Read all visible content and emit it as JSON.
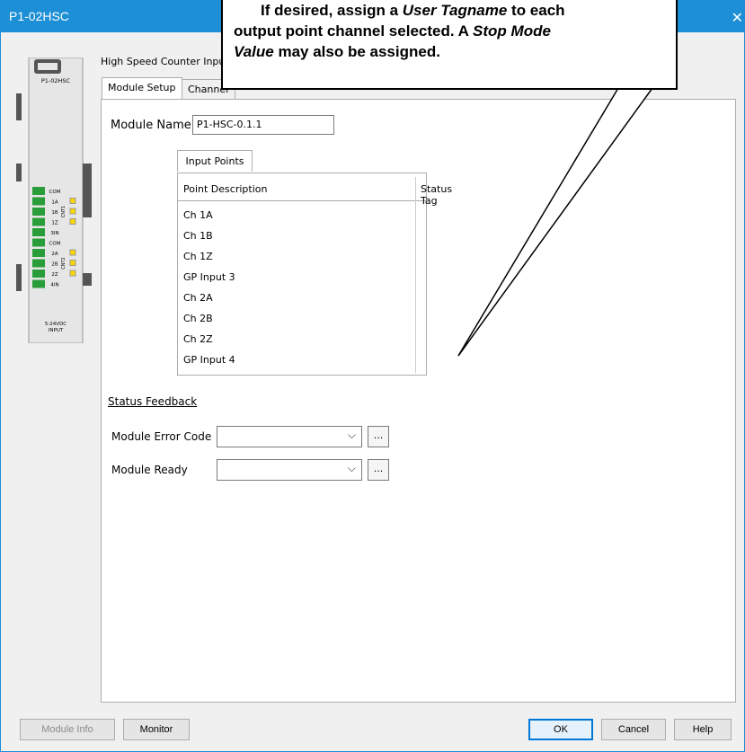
{
  "window": {
    "title": "P1-02HSC"
  },
  "module_image": {
    "part_number": "P1-02HSC",
    "terminals": [
      "COM",
      "1A",
      "1B",
      "1Z",
      "3IN",
      "COM",
      "2A",
      "2B",
      "2Z",
      "4IN"
    ],
    "channel_labels": [
      "CNT1",
      "CNT2"
    ],
    "footer": [
      "5-24VDC",
      "INPUT"
    ],
    "colors": {
      "led": "#ffd700",
      "terminal": "#2a9d3b"
    }
  },
  "group_caption": "High Speed Counter Input",
  "tabs": [
    "Module Setup",
    "Channel"
  ],
  "module_name": {
    "label": "Module Name",
    "value": "P1-HSC-0.1.1"
  },
  "input_points": {
    "tab_label": "Input Points",
    "columns": [
      "Point Description",
      "Status Tag"
    ],
    "rows": [
      "Ch 1A",
      "Ch 1B",
      "Ch 1Z",
      "GP Input 3",
      "Ch 2A",
      "Ch 2B",
      "Ch 2Z",
      "GP Input 4"
    ]
  },
  "status_feedback": {
    "title": "Status Feedback",
    "fields": [
      {
        "label": "Module Error Code",
        "value": ""
      },
      {
        "label": "Module Ready",
        "value": ""
      }
    ],
    "ellipsis": "..."
  },
  "buttons": {
    "module_info": "Module Info",
    "monitor": "Monitor",
    "ok": "OK",
    "cancel": "Cancel",
    "help": "Help"
  },
  "callout": {
    "line1_pre": "If desired, assign a ",
    "line1_em": "User Tagname",
    "line1_post": " to each",
    "line2_pre": "output point channel selected. A ",
    "line2_em": "Stop Mode",
    "line3_em": "Value",
    "line3_post": " may also be assigned."
  },
  "colors": {
    "titlebar": "#1c8fd6",
    "accent": "#0078d7"
  }
}
